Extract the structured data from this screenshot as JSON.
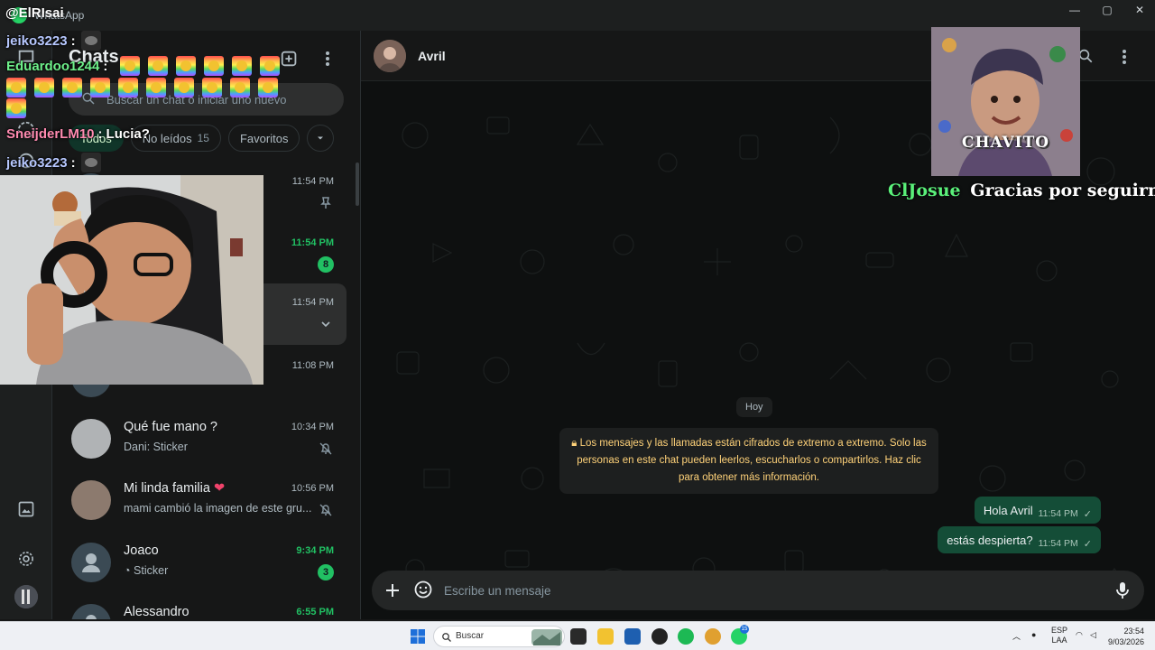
{
  "window": {
    "app_name": "WhatsApp",
    "controls": [
      "—",
      "▢",
      "✕"
    ]
  },
  "sidebar": {
    "title": "Chats",
    "search_placeholder": "Buscar un chat o iniciar uno nuevo",
    "filters": [
      {
        "label": "Todos",
        "count": "",
        "active": true
      },
      {
        "label": "No leídos",
        "count": "15",
        "active": false
      },
      {
        "label": "Favoritos",
        "count": "",
        "active": false
      }
    ],
    "chats": [
      {
        "name": "",
        "preview": "",
        "time": "11:54 PM",
        "unread": false,
        "badge": "",
        "icon": "pin-icon"
      },
      {
        "name": "",
        "preview": "",
        "time": "11:54 PM",
        "unread": true,
        "badge": "8",
        "icon": ""
      },
      {
        "name": "",
        "preview": "",
        "time": "11:54 PM",
        "unread": false,
        "badge": "",
        "icon": "chevron-down-icon"
      },
      {
        "name": "",
        "preview": "",
        "time": "11:08 PM",
        "unread": false,
        "badge": "",
        "icon": ""
      },
      {
        "name": "Qué fue mano ?",
        "preview": "Dani: Sticker",
        "time": "10:34 PM",
        "unread": false,
        "badge": "",
        "icon": "muted-icon"
      },
      {
        "name": "Mi linda familia",
        "preview": "mami cambió la imagen de este gru...",
        "time": "10:56 PM",
        "unread": false,
        "badge": "",
        "icon": "muted-icon"
      },
      {
        "name": "Joaco",
        "preview": "Sticker",
        "time": "9:34 PM",
        "unread": true,
        "badge": "3",
        "icon": ""
      },
      {
        "name": "Alessandro",
        "preview": "",
        "time": "6:55 PM",
        "unread": true,
        "badge": "",
        "icon": ""
      }
    ]
  },
  "conversation": {
    "contact_name": "Avril",
    "date_label": "Hoy",
    "system_message": "Los mensajes y las llamadas están cifrados de extremo a extremo. Solo las personas en este chat pueden leerlos, escucharlos o compartirlos. Haz clic para obtener más información.",
    "messages": [
      {
        "text": "Hola Avril",
        "time": "11:54 PM",
        "status": "✓"
      },
      {
        "text": "estás despierta?",
        "time": "11:54 PM",
        "status": "✓"
      }
    ],
    "composer_placeholder": "Escribe un mensaje"
  },
  "stream_overlay": {
    "channel": "@ElRIsai",
    "chat": [
      {
        "user": "jeiko3223",
        "sep": ":",
        "text": ""
      },
      {
        "user": "Eduardoo1244",
        "sep": ":",
        "text": ""
      },
      {
        "user": "SneijderLM10",
        "sep": ":",
        "text": "Lucia?"
      },
      {
        "user": "jeiko3223",
        "sep": ":",
        "text": ""
      }
    ],
    "alert_label": "CHAVITO",
    "alert_user": "ClJosue",
    "alert_text": "Gracias por seguirme!!"
  },
  "taskbar": {
    "search_label": "Buscar",
    "wa_badge": "15",
    "lang_top": "ESP",
    "lang_bottom": "LAA",
    "time": "23:54",
    "date": "9/03/2026"
  },
  "colors": {
    "accent_green": "#21c063",
    "outgoing_bubble": "#144d37",
    "system_text": "#ffd279"
  }
}
